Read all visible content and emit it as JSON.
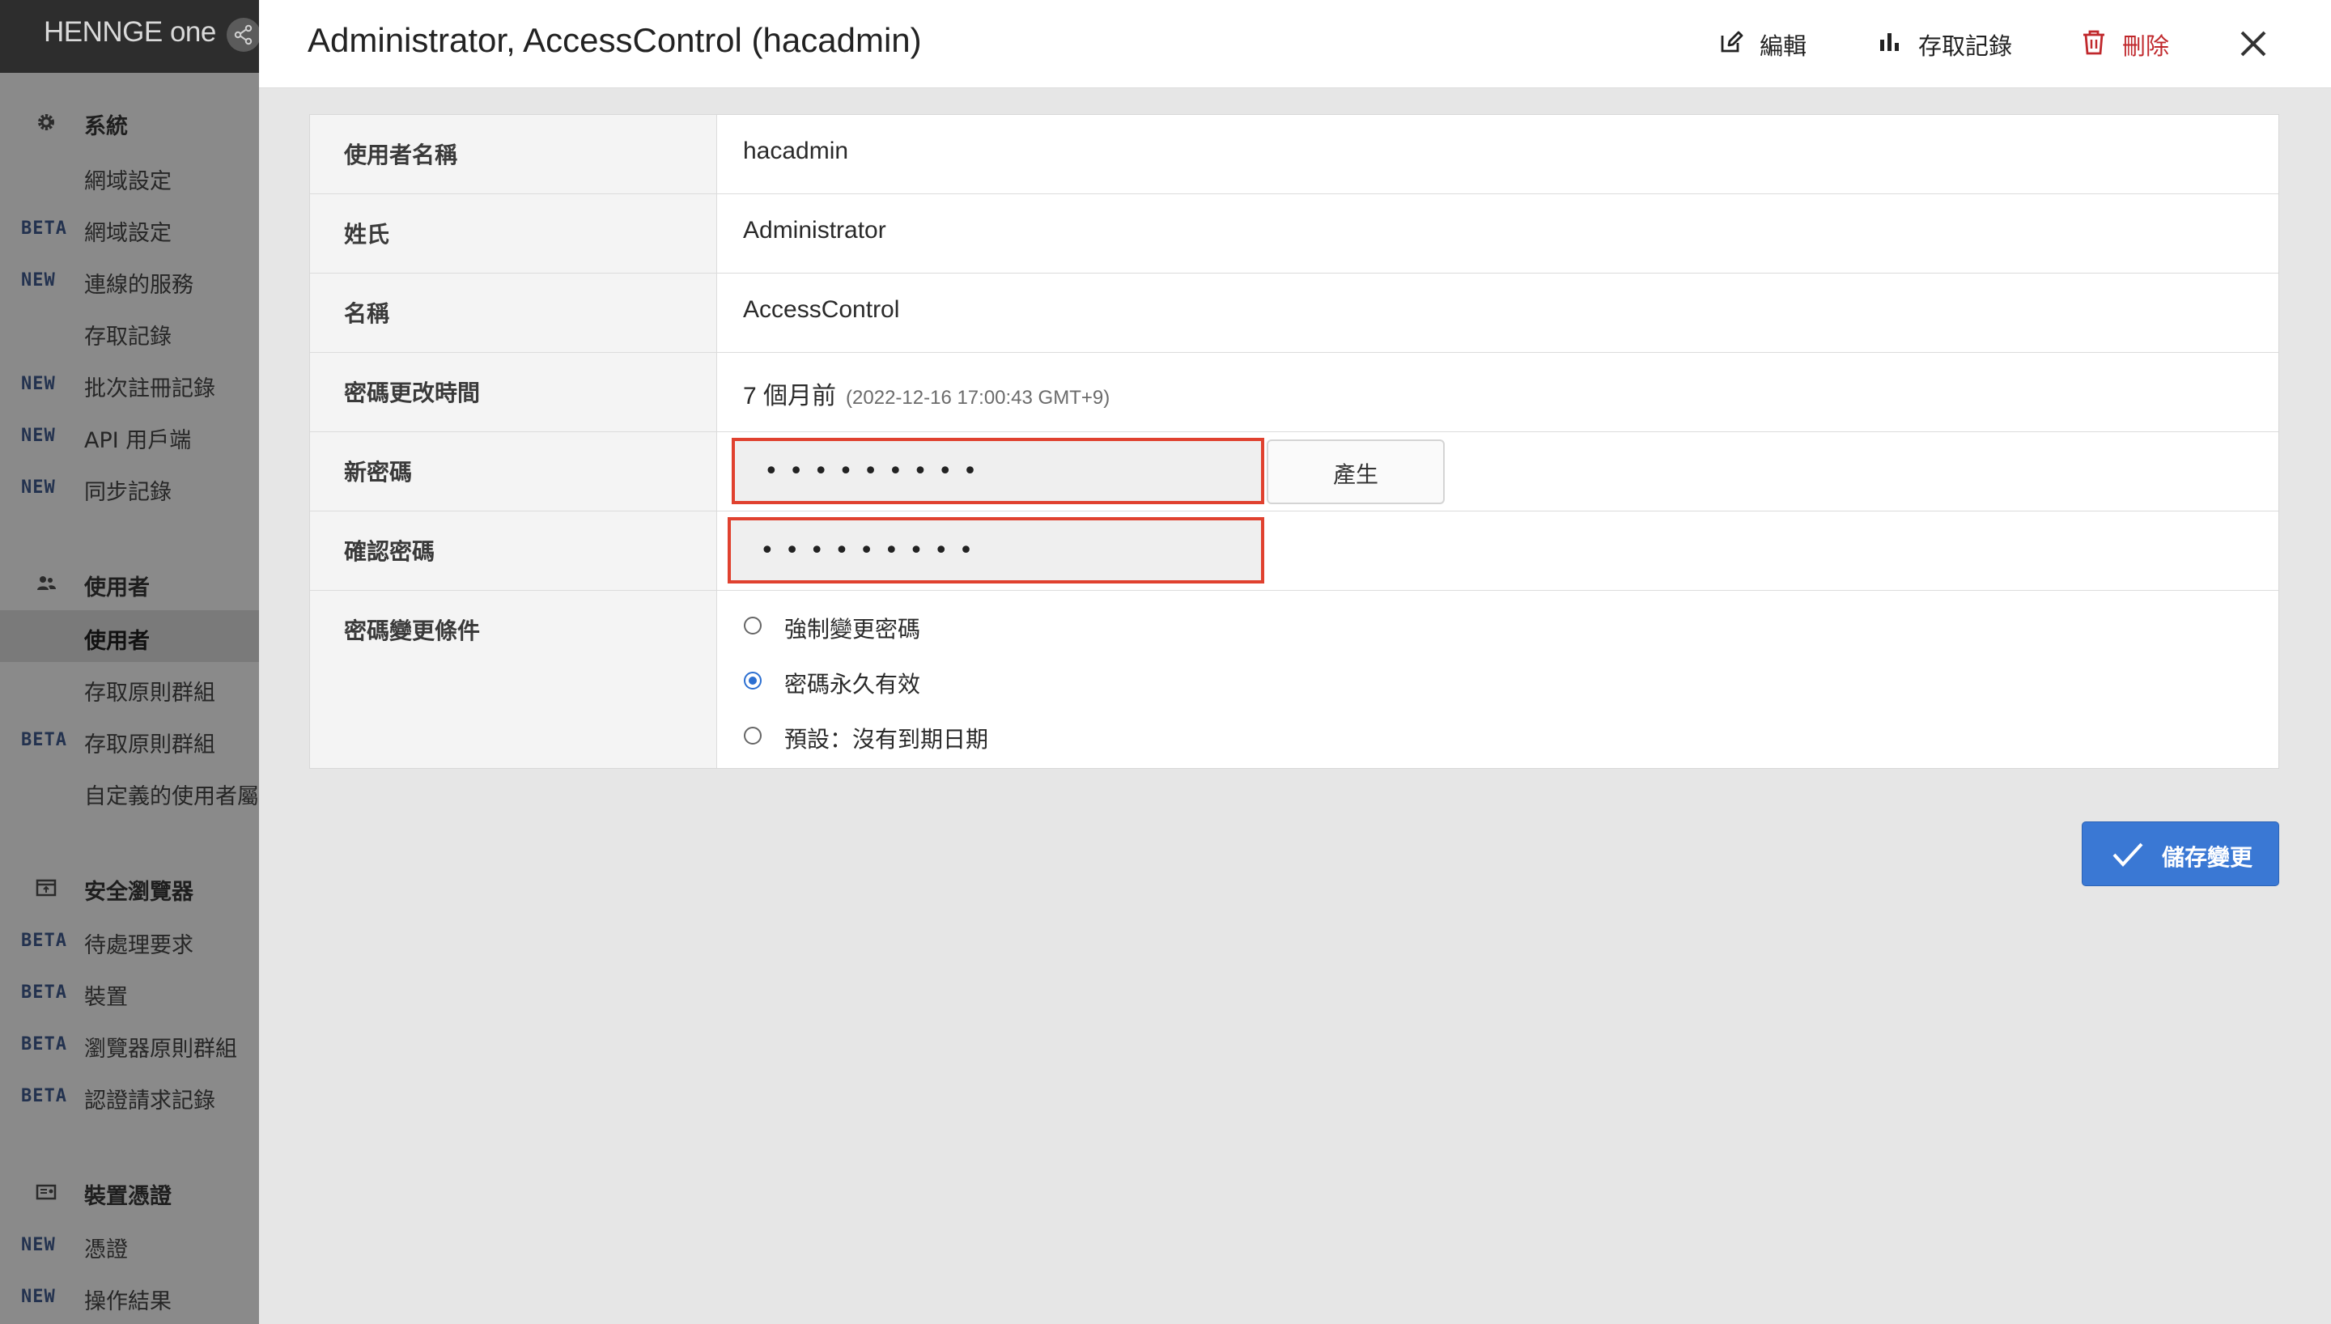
{
  "brand": {
    "logo_text": "HENNGE one"
  },
  "sidebar": {
    "sections": [
      {
        "label": "系統",
        "icon": "gear-icon"
      },
      {
        "label": "使用者",
        "icon": "users-icon"
      },
      {
        "label": "安全瀏覽器",
        "icon": "browser-window-icon"
      },
      {
        "label": "裝置憑證",
        "icon": "certificate-card-icon"
      }
    ],
    "items": [
      {
        "badge": "",
        "label": "網域設定"
      },
      {
        "badge": "BETA",
        "label": "網域設定"
      },
      {
        "badge": "NEW",
        "label": "連線的服務"
      },
      {
        "badge": "",
        "label": "存取記錄"
      },
      {
        "badge": "NEW",
        "label": "批次註冊記錄"
      },
      {
        "badge": "NEW",
        "label": "API 用戶端"
      },
      {
        "badge": "NEW",
        "label": "同步記錄"
      },
      {
        "badge": "",
        "label": "使用者"
      },
      {
        "badge": "",
        "label": "存取原則群組"
      },
      {
        "badge": "BETA",
        "label": "存取原則群組"
      },
      {
        "badge": "",
        "label": "自定義的使用者屬性"
      },
      {
        "badge": "BETA",
        "label": "待處理要求"
      },
      {
        "badge": "BETA",
        "label": "裝置"
      },
      {
        "badge": "BETA",
        "label": "瀏覽器原則群組"
      },
      {
        "badge": "BETA",
        "label": "認證請求記錄"
      },
      {
        "badge": "NEW",
        "label": "憑證"
      },
      {
        "badge": "NEW",
        "label": "操作結果"
      }
    ]
  },
  "header": {
    "title": "Administrator, AccessControl (hacadmin)",
    "edit_label": "編輯",
    "access_log_label": "存取記錄",
    "delete_label": "刪除"
  },
  "form": {
    "username_label": "使用者名稱",
    "username_value": "hacadmin",
    "last_name_label": "姓氏",
    "last_name_value": "Administrator",
    "first_name_label": "名稱",
    "first_name_value": "AccessControl",
    "pw_changed_label": "密碼更改時間",
    "pw_changed_value": "7 個月前",
    "pw_changed_detail": "(2022-12-16 17:00:43 GMT+9)",
    "new_pw_label": "新密碼",
    "new_pw_mask": "•••••••••",
    "generate_label": "產生",
    "confirm_pw_label": "確認密碼",
    "confirm_pw_mask": "•••••••••",
    "policy_label": "密碼變更條件",
    "policy_options": [
      {
        "label": "強制變更密碼",
        "selected": false
      },
      {
        "label": "密碼永久有效",
        "selected": true
      },
      {
        "label": "預設：沒有到期日期",
        "selected": false
      }
    ]
  },
  "save_label": "儲存變更",
  "colors": {
    "accent": "#3a78d4",
    "danger": "#c0282c",
    "highlight_border": "#e0412f",
    "sidebar_bg": "#8a8a8a",
    "sidebar_top": "#2d2d2d"
  }
}
